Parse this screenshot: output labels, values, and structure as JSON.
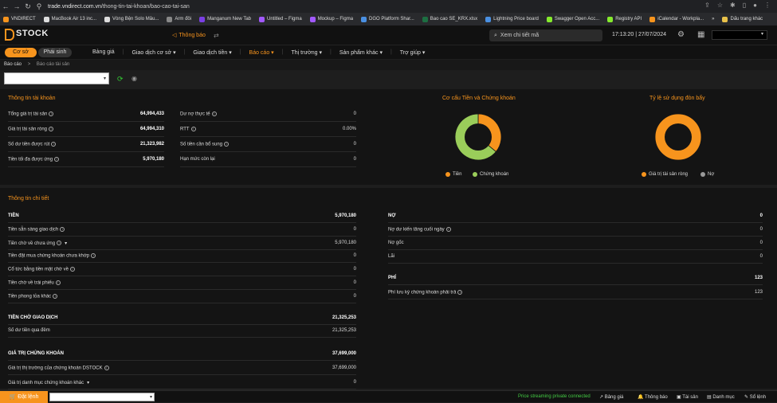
{
  "browser": {
    "url_host": "trade.vndirect.com.vn",
    "url_path": "/thong-tin-tai-khoan/bao-cao-tai-san",
    "bookmarks": [
      {
        "label": "VNDIRECT",
        "color": "#f7941d"
      },
      {
        "label": "MacBook Air 13 inc...",
        "color": "#dddddd"
      },
      {
        "label": "Vòng Bện Solo Mâu...",
        "color": "#dddddd"
      },
      {
        "label": "Arm đôi",
        "color": "#888888"
      },
      {
        "label": "Manganum New Tab",
        "color": "#7b3fe4"
      },
      {
        "label": "Untitled – Figma",
        "color": "#a259ff"
      },
      {
        "label": "Mockup – Figma",
        "color": "#a259ff"
      },
      {
        "label": "DGO Platform Shar...",
        "color": "#4a90e2"
      },
      {
        "label": "Bao cao SE_KRX.xlsx",
        "color": "#1d6f42"
      },
      {
        "label": "Lightning Price board",
        "color": "#4a90e2"
      },
      {
        "label": "Swagger Open Acc...",
        "color": "#85ea2d"
      },
      {
        "label": "Registry API",
        "color": "#85ea2d"
      },
      {
        "label": "iCalendar - Workpla...",
        "color": "#f7941d"
      }
    ],
    "bookmarks_more": "»",
    "bookmarks_folder": "Dấu trang khác"
  },
  "header": {
    "logo_text": "STOCK",
    "logo_letter": "D",
    "notification_label": "Thông báo",
    "search_placeholder": "Xem chi tiết mã",
    "clock": "17:13:20 | 27/07/2024"
  },
  "nav": {
    "tab_coso": "Cơ sở",
    "tab_phaisinh": "Phái sinh",
    "menu": [
      {
        "label": "Bảng giá",
        "caret": ""
      },
      {
        "label": "Giao dịch cơ sở",
        "caret": "▾"
      },
      {
        "label": "Giao dịch tiền",
        "caret": "▾"
      },
      {
        "label": "Báo cáo",
        "caret": "▾"
      },
      {
        "label": "Thị trường",
        "caret": "▾"
      },
      {
        "label": "Sản phẩm khác",
        "caret": "▾"
      },
      {
        "label": "Trợ giúp",
        "caret": "▾"
      }
    ]
  },
  "breadcrumb": {
    "level1": "Báo cáo",
    "sep": ">",
    "level2": "Báo cáo tài sản"
  },
  "account_info": {
    "title": "Thông tin tài khoản",
    "left": [
      {
        "label": "Tổng giá trị tài sản",
        "value": "64,994,433"
      },
      {
        "label": "Giá trị tài sản ròng",
        "value": "64,994,310"
      },
      {
        "label": "Số dư tiền được rút",
        "value": "21,323,982"
      },
      {
        "label": "Tiền tối đa được ứng",
        "value": "5,970,180"
      }
    ],
    "right": [
      {
        "label": "Dư nợ thực tế",
        "value": "0"
      },
      {
        "label": "RTT",
        "value": "0.00%"
      },
      {
        "label": "Số tiền cần bổ sung",
        "value": "0"
      },
      {
        "label": "Hạn mức còn lại",
        "value": "0"
      }
    ]
  },
  "chart_data": [
    {
      "type": "pie",
      "title": "Cơ cấu Tiền và Chứng khoán",
      "categories": [
        "Tiền",
        "Chứng khoán"
      ],
      "values": [
        36,
        64
      ],
      "colors": [
        "#f7941d",
        "#9acd5a"
      ]
    },
    {
      "type": "pie",
      "title": "Tỷ lệ sử dụng đòn bẩy",
      "categories": [
        "Giá trị tài sản ròng",
        "Nợ"
      ],
      "values": [
        100,
        0
      ],
      "colors": [
        "#f7941d",
        "#999999"
      ]
    }
  ],
  "detail": {
    "title": "Thông tin chi tiết",
    "tien": {
      "header": "TIỀN",
      "total": "5,970,180",
      "rows": [
        {
          "label": "Tiền sẵn sàng giao dịch",
          "value": "0",
          "info": true
        },
        {
          "label": "Tiền chờ về chưa ứng",
          "value": "5,970,180",
          "info": true,
          "caret": true
        },
        {
          "label": "Tiền đặt mua chứng khoán chưa khớp",
          "value": "0",
          "info": true
        },
        {
          "label": "Cổ tức bằng tiền mặt chờ về",
          "value": "0",
          "info": true
        },
        {
          "label": "Tiền chờ về trái phiếu",
          "value": "0",
          "info": true
        },
        {
          "label": "Tiền phong tỏa khác",
          "value": "0",
          "info": true
        }
      ]
    },
    "tien_cho": {
      "header": "TIỀN CHỜ GIAO DỊCH",
      "total": "21,325,253",
      "rows": [
        {
          "label": "Số dư tiền qua đêm",
          "value": "21,325,253"
        }
      ]
    },
    "chung_khoan": {
      "header": "GIÁ TRỊ CHỨNG KHOÁN",
      "total": "37,699,000",
      "rows": [
        {
          "label": "Giá trị thị trường của chứng khoán DSTOCK",
          "value": "37,699,000",
          "info": true
        },
        {
          "label": "Giá trị danh mục chứng khoán khác",
          "value": "0",
          "caret": true
        }
      ]
    },
    "no": {
      "header": "NỢ",
      "total": "0",
      "rows": [
        {
          "label": "Nợ dư kiến tăng cuối ngày",
          "value": "0",
          "info": true
        },
        {
          "label": "Nợ gốc",
          "value": "0"
        },
        {
          "label": "Lãi",
          "value": "0"
        }
      ]
    },
    "phi": {
      "header": "PHÍ",
      "total": "123",
      "rows": [
        {
          "label": "Phí lưu ký chứng khoán phải trả",
          "value": "123",
          "info": true
        }
      ]
    }
  },
  "statusbar": {
    "order_button": "Đặt lệnh",
    "streaming": "Price streaming private connected",
    "buttons": [
      "Bảng giá",
      "Thông báo",
      "Tài sản",
      "Danh mục",
      "Sổ lệnh"
    ]
  }
}
